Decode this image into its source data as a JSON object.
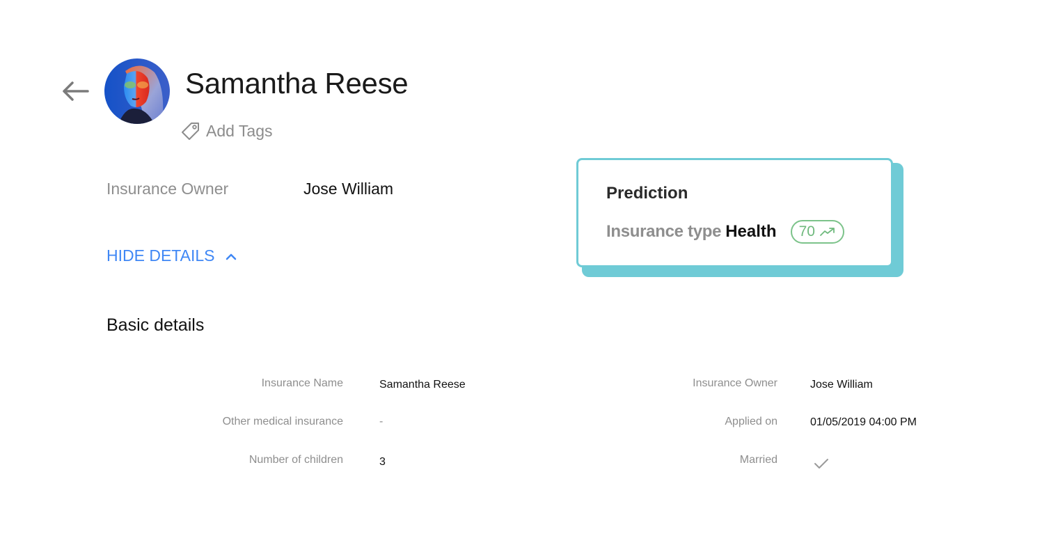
{
  "header": {
    "back_icon": "arrow-left-icon",
    "avatar_alt": "Samantha Reese avatar",
    "name": "Samantha Reese",
    "add_tags_icon": "tag-icon",
    "add_tags_label": "Add Tags"
  },
  "owner": {
    "label": "Insurance Owner",
    "value": "Jose William"
  },
  "toggle": {
    "label": "HIDE DETAILS",
    "icon": "chevron-up-icon"
  },
  "prediction": {
    "title": "Prediction",
    "label": "Insurance type",
    "value": "Health",
    "score": "70",
    "score_icon": "trending-up-icon",
    "accent_color": "#6fcbd6",
    "score_color": "#7cc38a"
  },
  "basic_details": {
    "title": "Basic details",
    "left": [
      {
        "label": "Insurance Name",
        "value": "Samantha Reese"
      },
      {
        "label": "Other medical insurance",
        "value": "-"
      },
      {
        "label": "Number of children",
        "value": "3"
      }
    ],
    "right": [
      {
        "label": "Insurance Owner",
        "value": "Jose William"
      },
      {
        "label": "Applied on",
        "value": "01/05/2019 04:00 PM"
      },
      {
        "label": "Married",
        "value": "",
        "icon": "checkmark-icon",
        "checked": true
      }
    ]
  },
  "colors": {
    "link": "#3f87f5",
    "label": "#8e8e8e",
    "text": "#111111"
  }
}
